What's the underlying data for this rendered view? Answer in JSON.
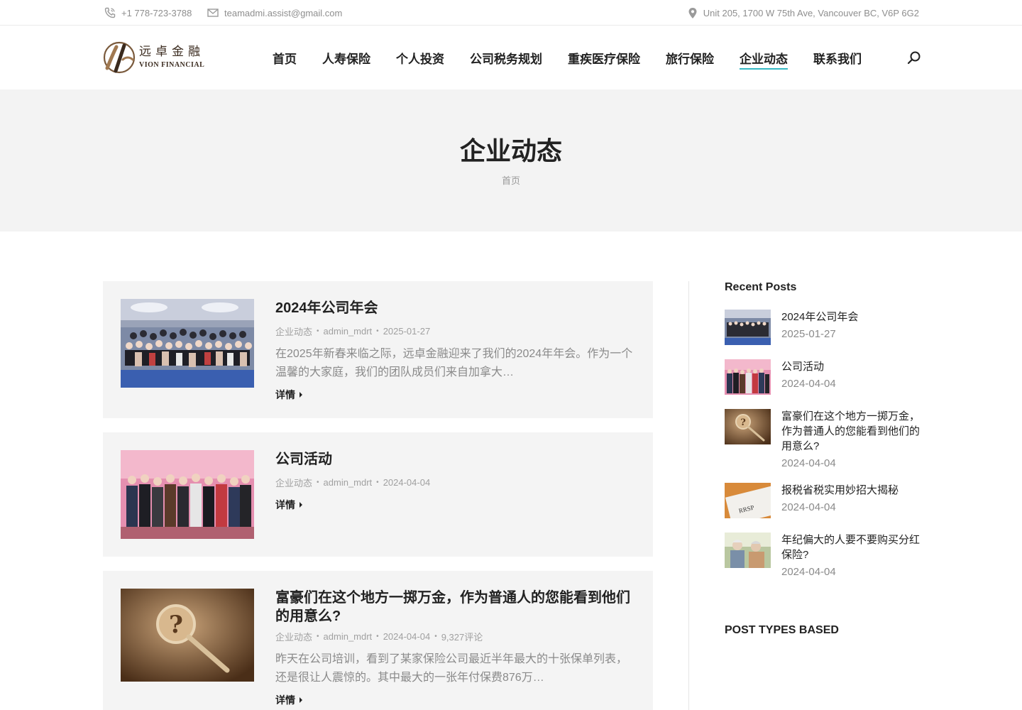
{
  "topbar": {
    "phone": "+1 778-723-3788",
    "email": "teamadmi.assist@gmail.com",
    "address": "Unit 205, 1700 W 75th Ave, Vancouver BC, V6P 6G2"
  },
  "logo": {
    "cn": "远卓金融",
    "en": "VION FINANCIAL"
  },
  "nav": [
    {
      "label": "首页"
    },
    {
      "label": "人寿保险"
    },
    {
      "label": "个人投资"
    },
    {
      "label": "公司税务规划"
    },
    {
      "label": "重疾医疗保险"
    },
    {
      "label": "旅行保险"
    },
    {
      "label": "企业动态",
      "active": true
    },
    {
      "label": "联系我们"
    }
  ],
  "page": {
    "title": "企业动态",
    "breadcrumb": "首页"
  },
  "posts": [
    {
      "title": "2024年公司年会",
      "category": "企业动态",
      "author": "admin_mdrt",
      "date": "2025-01-27",
      "comments": "",
      "excerpt": "在2025年新春来临之际，远卓金融迎来了我们的2024年年会。作为一个温馨的大家庭，我们的团队成员们来自加拿大…",
      "more": "详情"
    },
    {
      "title": "公司活动",
      "category": "企业动态",
      "author": "admin_mdrt",
      "date": "2024-04-04",
      "comments": "",
      "excerpt": "",
      "more": "详情"
    },
    {
      "title": "富豪们在这个地方一掷万金，作为普通人的您能看到他们的用意么?",
      "category": "企业动态",
      "author": "admin_mdrt",
      "date": "2024-04-04",
      "comments": "9,327评论",
      "excerpt": "昨天在公司培训，看到了某家保险公司最近半年最大的十张保单列表，还是很让人震惊的。其中最大的一张年付保费876万…",
      "more": "详情"
    }
  ],
  "sidebar": {
    "recent_heading": "Recent Posts",
    "recent": [
      {
        "title": "2024年公司年会",
        "date": "2025-01-27"
      },
      {
        "title": "公司活动",
        "date": "2024-04-04"
      },
      {
        "title": "富豪们在这个地方一掷万金，作为普通人的您能看到他们的用意么?",
        "date": "2024-04-04"
      },
      {
        "title": "报税省税实用妙招大揭秘",
        "date": "2024-04-04"
      },
      {
        "title": "年纪偏大的人要不要购买分红保险?",
        "date": "2024-04-04"
      }
    ],
    "post_types_heading": "POST TYPES BASED",
    "rrsp_label": "RRSP"
  },
  "colors": {
    "accent": "#35b8c3",
    "logo_gold": "#a07850",
    "band_bg": "#f3f3f3"
  }
}
